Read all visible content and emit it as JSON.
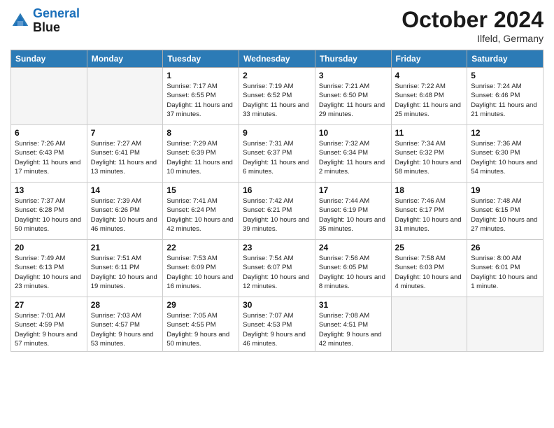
{
  "logo": {
    "line1": "General",
    "line2": "Blue"
  },
  "title": "October 2024",
  "location": "Ilfeld, Germany",
  "days_of_week": [
    "Sunday",
    "Monday",
    "Tuesday",
    "Wednesday",
    "Thursday",
    "Friday",
    "Saturday"
  ],
  "weeks": [
    [
      {
        "day": "",
        "empty": true
      },
      {
        "day": "",
        "empty": true
      },
      {
        "day": "1",
        "sunrise": "7:17 AM",
        "sunset": "6:55 PM",
        "daylight": "11 hours and 37 minutes."
      },
      {
        "day": "2",
        "sunrise": "7:19 AM",
        "sunset": "6:52 PM",
        "daylight": "11 hours and 33 minutes."
      },
      {
        "day": "3",
        "sunrise": "7:21 AM",
        "sunset": "6:50 PM",
        "daylight": "11 hours and 29 minutes."
      },
      {
        "day": "4",
        "sunrise": "7:22 AM",
        "sunset": "6:48 PM",
        "daylight": "11 hours and 25 minutes."
      },
      {
        "day": "5",
        "sunrise": "7:24 AM",
        "sunset": "6:46 PM",
        "daylight": "11 hours and 21 minutes."
      }
    ],
    [
      {
        "day": "6",
        "sunrise": "7:26 AM",
        "sunset": "6:43 PM",
        "daylight": "11 hours and 17 minutes."
      },
      {
        "day": "7",
        "sunrise": "7:27 AM",
        "sunset": "6:41 PM",
        "daylight": "11 hours and 13 minutes."
      },
      {
        "day": "8",
        "sunrise": "7:29 AM",
        "sunset": "6:39 PM",
        "daylight": "11 hours and 10 minutes."
      },
      {
        "day": "9",
        "sunrise": "7:31 AM",
        "sunset": "6:37 PM",
        "daylight": "11 hours and 6 minutes."
      },
      {
        "day": "10",
        "sunrise": "7:32 AM",
        "sunset": "6:34 PM",
        "daylight": "11 hours and 2 minutes."
      },
      {
        "day": "11",
        "sunrise": "7:34 AM",
        "sunset": "6:32 PM",
        "daylight": "10 hours and 58 minutes."
      },
      {
        "day": "12",
        "sunrise": "7:36 AM",
        "sunset": "6:30 PM",
        "daylight": "10 hours and 54 minutes."
      }
    ],
    [
      {
        "day": "13",
        "sunrise": "7:37 AM",
        "sunset": "6:28 PM",
        "daylight": "10 hours and 50 minutes."
      },
      {
        "day": "14",
        "sunrise": "7:39 AM",
        "sunset": "6:26 PM",
        "daylight": "10 hours and 46 minutes."
      },
      {
        "day": "15",
        "sunrise": "7:41 AM",
        "sunset": "6:24 PM",
        "daylight": "10 hours and 42 minutes."
      },
      {
        "day": "16",
        "sunrise": "7:42 AM",
        "sunset": "6:21 PM",
        "daylight": "10 hours and 39 minutes."
      },
      {
        "day": "17",
        "sunrise": "7:44 AM",
        "sunset": "6:19 PM",
        "daylight": "10 hours and 35 minutes."
      },
      {
        "day": "18",
        "sunrise": "7:46 AM",
        "sunset": "6:17 PM",
        "daylight": "10 hours and 31 minutes."
      },
      {
        "day": "19",
        "sunrise": "7:48 AM",
        "sunset": "6:15 PM",
        "daylight": "10 hours and 27 minutes."
      }
    ],
    [
      {
        "day": "20",
        "sunrise": "7:49 AM",
        "sunset": "6:13 PM",
        "daylight": "10 hours and 23 minutes."
      },
      {
        "day": "21",
        "sunrise": "7:51 AM",
        "sunset": "6:11 PM",
        "daylight": "10 hours and 19 minutes."
      },
      {
        "day": "22",
        "sunrise": "7:53 AM",
        "sunset": "6:09 PM",
        "daylight": "10 hours and 16 minutes."
      },
      {
        "day": "23",
        "sunrise": "7:54 AM",
        "sunset": "6:07 PM",
        "daylight": "10 hours and 12 minutes."
      },
      {
        "day": "24",
        "sunrise": "7:56 AM",
        "sunset": "6:05 PM",
        "daylight": "10 hours and 8 minutes."
      },
      {
        "day": "25",
        "sunrise": "7:58 AM",
        "sunset": "6:03 PM",
        "daylight": "10 hours and 4 minutes."
      },
      {
        "day": "26",
        "sunrise": "8:00 AM",
        "sunset": "6:01 PM",
        "daylight": "10 hours and 1 minute."
      }
    ],
    [
      {
        "day": "27",
        "sunrise": "7:01 AM",
        "sunset": "4:59 PM",
        "daylight": "9 hours and 57 minutes."
      },
      {
        "day": "28",
        "sunrise": "7:03 AM",
        "sunset": "4:57 PM",
        "daylight": "9 hours and 53 minutes."
      },
      {
        "day": "29",
        "sunrise": "7:05 AM",
        "sunset": "4:55 PM",
        "daylight": "9 hours and 50 minutes."
      },
      {
        "day": "30",
        "sunrise": "7:07 AM",
        "sunset": "4:53 PM",
        "daylight": "9 hours and 46 minutes."
      },
      {
        "day": "31",
        "sunrise": "7:08 AM",
        "sunset": "4:51 PM",
        "daylight": "9 hours and 42 minutes."
      },
      {
        "day": "",
        "empty": true
      },
      {
        "day": "",
        "empty": true
      }
    ]
  ]
}
